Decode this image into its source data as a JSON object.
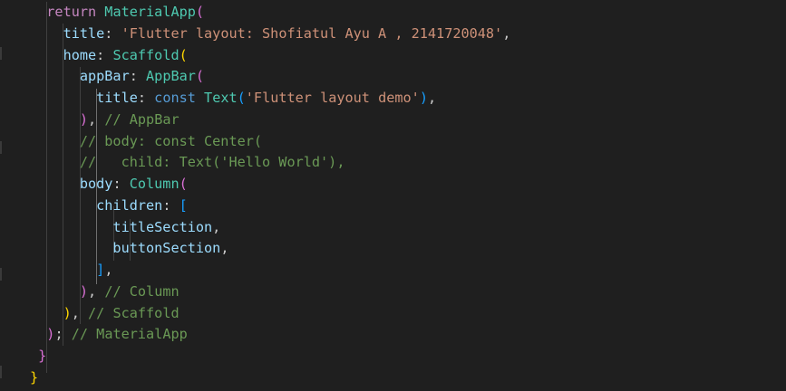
{
  "editor": {
    "lines": [
      [
        {
          "t": "  return ",
          "c": "ctl"
        },
        {
          "t": "MaterialApp",
          "c": "cls"
        },
        {
          "t": "(",
          "c": "p2"
        }
      ],
      [
        {
          "t": "    title",
          "c": "prop"
        },
        {
          "t": ": ",
          "c": "punc"
        },
        {
          "t": "'Flutter layout: Shofiatul Ayu A , 2141720048'",
          "c": "str"
        },
        {
          "t": ",",
          "c": "punc"
        }
      ],
      [
        {
          "t": "    home",
          "c": "prop"
        },
        {
          "t": ": ",
          "c": "punc"
        },
        {
          "t": "Scaffold",
          "c": "cls"
        },
        {
          "t": "(",
          "c": "p1"
        }
      ],
      [
        {
          "t": "      appBar",
          "c": "prop"
        },
        {
          "t": ": ",
          "c": "punc"
        },
        {
          "t": "AppBar",
          "c": "cls"
        },
        {
          "t": "(",
          "c": "p2"
        }
      ],
      [
        {
          "t": "        title",
          "c": "prop"
        },
        {
          "t": ": ",
          "c": "punc"
        },
        {
          "t": "const ",
          "c": "kwb"
        },
        {
          "t": "Text",
          "c": "cls"
        },
        {
          "t": "(",
          "c": "p3"
        },
        {
          "t": "'Flutter layout demo'",
          "c": "str"
        },
        {
          "t": ")",
          "c": "p3"
        },
        {
          "t": ",",
          "c": "punc"
        }
      ],
      [
        {
          "t": "      ",
          "c": "punc"
        },
        {
          "t": ")",
          "c": "p2"
        },
        {
          "t": ", ",
          "c": "punc"
        },
        {
          "t": "// AppBar",
          "c": "cmt"
        }
      ],
      [
        {
          "t": "      // body: const Center(",
          "c": "cmt"
        }
      ],
      [
        {
          "t": "      //   child: Text('Hello World'),",
          "c": "cmt"
        }
      ],
      [
        {
          "t": "      body",
          "c": "prop"
        },
        {
          "t": ": ",
          "c": "punc"
        },
        {
          "t": "Column",
          "c": "cls"
        },
        {
          "t": "(",
          "c": "p2"
        }
      ],
      [
        {
          "t": "        children",
          "c": "prop"
        },
        {
          "t": ": ",
          "c": "punc"
        },
        {
          "t": "[",
          "c": "p3"
        }
      ],
      [
        {
          "t": "          titleSection",
          "c": "ident"
        },
        {
          "t": ",",
          "c": "punc"
        }
      ],
      [
        {
          "t": "          buttonSection",
          "c": "ident"
        },
        {
          "t": ",",
          "c": "punc"
        }
      ],
      [
        {
          "t": "        ",
          "c": "punc"
        },
        {
          "t": "]",
          "c": "p3"
        },
        {
          "t": ",",
          "c": "punc"
        }
      ],
      [
        {
          "t": "      ",
          "c": "punc"
        },
        {
          "t": ")",
          "c": "p2"
        },
        {
          "t": ", ",
          "c": "punc"
        },
        {
          "t": "// Column",
          "c": "cmt"
        }
      ],
      [
        {
          "t": "    ",
          "c": "punc"
        },
        {
          "t": ")",
          "c": "p1"
        },
        {
          "t": ", ",
          "c": "punc"
        },
        {
          "t": "// Scaffold",
          "c": "cmt"
        }
      ],
      [
        {
          "t": "  ",
          "c": "punc"
        },
        {
          "t": ")",
          "c": "p2"
        },
        {
          "t": "; ",
          "c": "punc"
        },
        {
          "t": "// MaterialApp",
          "c": "cmt"
        }
      ],
      [
        {
          "t": " ",
          "c": "punc"
        },
        {
          "t": "}",
          "c": "p2"
        }
      ],
      [
        {
          "t": "}",
          "c": "p1"
        }
      ]
    ]
  }
}
